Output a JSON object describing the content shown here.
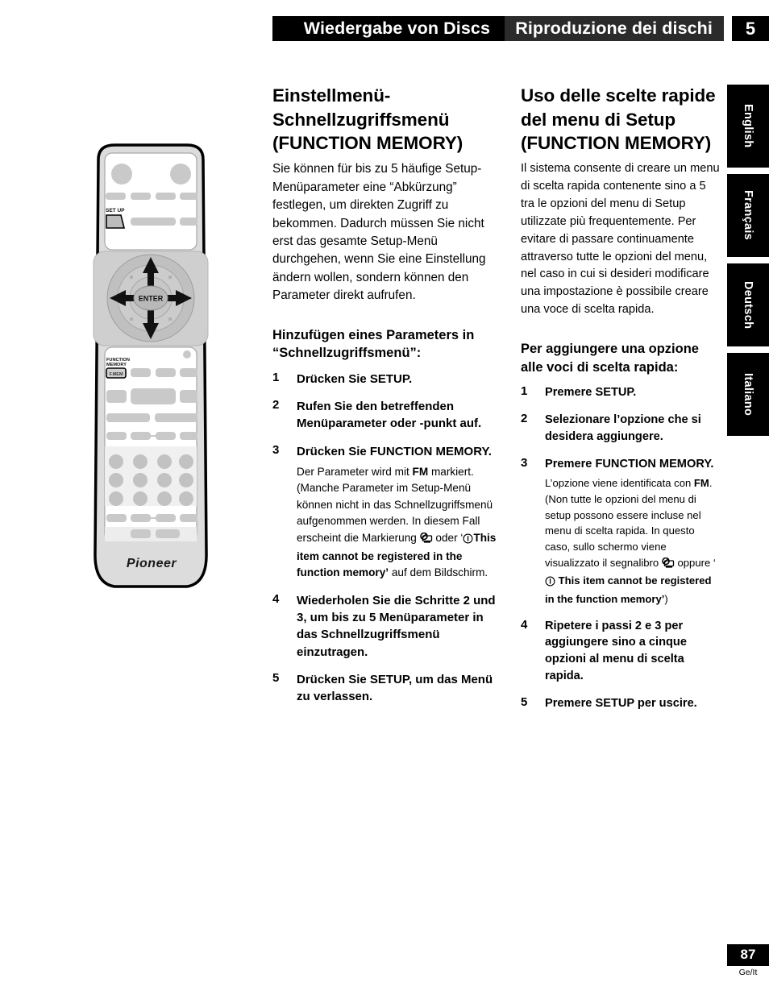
{
  "header": {
    "german_title": "Wiedergabe von Discs",
    "italian_title": "Riproduzione dei dischi",
    "chapter_number": "5",
    "colors": {
      "black": "#000000",
      "dark_gray": "#2b2b2b"
    }
  },
  "language_tabs": [
    {
      "label": "English"
    },
    {
      "label": "Français"
    },
    {
      "label": "Deutsch"
    },
    {
      "label": "Italiano"
    }
  ],
  "german": {
    "section_title": "Einstellmenü-Schnellzugriffsmenü (FUNCTION MEMORY)",
    "intro": "Sie können für bis zu 5 häufige Setup-Menüparameter eine “Abkürzung” festlegen, um direkten Zugriff zu bekommen. Dadurch müssen Sie nicht erst das gesamte Setup-Menü durchgehen, wenn Sie eine Einstellung ändern wollen, sondern können den Parameter direkt aufrufen.",
    "sub_title": "Hinzufügen eines Parameters in “Schnellzugriffsmenü”:",
    "steps": [
      {
        "num": "1",
        "head": "Drücken Sie SETUP."
      },
      {
        "num": "2",
        "head": "Rufen Sie den betreffenden Menüparameter oder -punkt auf."
      },
      {
        "num": "3",
        "head": "Drücken Sie FUNCTION MEMORY.",
        "note_a": "Der Parameter wird mit ",
        "note_fm": "FM",
        "note_b": " markiert. (Manche Parameter im Setup-Menü können nicht in das Schnellzugriffsmenü aufgenommen werden.  In diesem Fall erscheint die Markierung ",
        "note_c": " oder ‘",
        "note_bold": "This item cannot be registered in the function memory’",
        "note_d": " auf dem Bildschirm."
      },
      {
        "num": "4",
        "head": "Wiederholen Sie die Schritte 2 und 3, um bis zu 5 Menüparameter in das Schnellzugriffsmenü einzutragen."
      },
      {
        "num": "5",
        "head": "Drücken Sie SETUP, um das Menü zu verlassen."
      }
    ]
  },
  "italian": {
    "section_title": "Uso delle scelte rapide del menu di Setup (FUNCTION MEMORY)",
    "intro": "Il sistema consente di creare un menu di scelta rapida contenente sino a 5 tra le opzioni del menu di Setup utilizzate più frequentemente. Per evitare di passare continuamente attraverso tutte le opzioni del menu, nel caso in cui si desideri modificare una impostazione è possibile creare una voce di scelta rapida.",
    "sub_title": "Per aggiungere una opzione alle voci di scelta rapida:",
    "steps": [
      {
        "num": "1",
        "head": "Premere SETUP."
      },
      {
        "num": "2",
        "head": "Selezionare l’opzione che si desidera aggiungere."
      },
      {
        "num": "3",
        "head": "Premere FUNCTION MEMORY.",
        "note_a": "L’opzione viene identificata con ",
        "note_fm": "FM",
        "note_b": ". (Non tutte le opzioni del menu di setup possono essere incluse nel menu di scelta rapida.  In questo caso, sullo schermo viene visualizzato il segnalibro ",
        "note_c": " oppure ‘ ",
        "note_bold": "This item cannot be registered in the function memory’",
        "note_d": ")"
      },
      {
        "num": "4",
        "head": "Ripetere i passi 2 e 3 per aggiungere sino a cinque opzioni al menu di scelta rapida."
      },
      {
        "num": "5",
        "head": "Premere SETUP per uscire."
      }
    ]
  },
  "remote": {
    "setup_label": "SET UP",
    "function_memory_label_line1": "FUNCTION",
    "function_memory_label_line2": "MEMORY",
    "function_memory_button_text": "F.MEM",
    "enter_label": "ENTER",
    "brand": "Pioneer"
  },
  "footer": {
    "page_number": "87",
    "language_code": "Ge/It"
  }
}
